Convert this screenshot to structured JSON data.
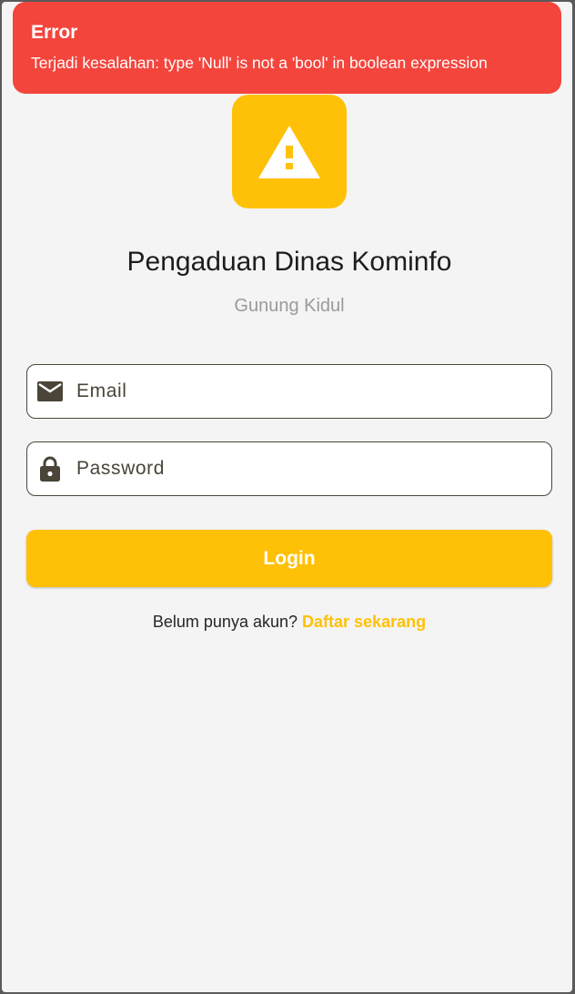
{
  "snackbar": {
    "title": "Error",
    "message": "Terjadi kesalahan: type 'Null' is not a 'bool' in boolean expression",
    "color": "#f4453c"
  },
  "app": {
    "logo_icon": "warning-icon",
    "title": "Pengaduan Dinas Kominfo",
    "subtitle": "Gunung Kidul",
    "accent_color": "#ffc107"
  },
  "form": {
    "email": {
      "icon": "mail-icon",
      "placeholder": "Email",
      "value": ""
    },
    "password": {
      "icon": "lock-icon",
      "placeholder": "Password",
      "value": ""
    },
    "login_label": "Login"
  },
  "register": {
    "prompt": "Belum punya akun?",
    "link_label": "Daftar sekarang"
  }
}
